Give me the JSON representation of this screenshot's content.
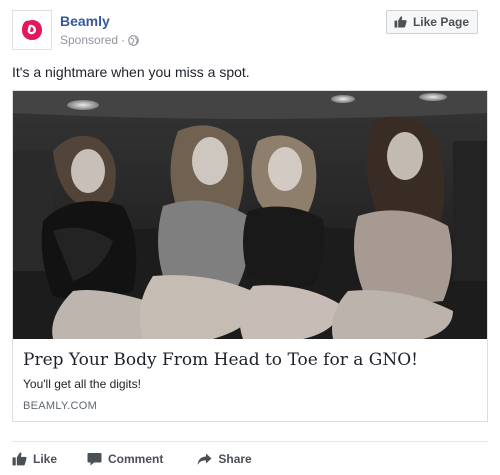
{
  "header": {
    "page_name": "Beamly",
    "sponsored": "Sponsored",
    "separator": "·",
    "like_page_label": "Like Page",
    "brand_color": "#e3175c"
  },
  "post": {
    "text": "It's a nightmare when you miss a spot."
  },
  "card": {
    "image_icon": "photo-four-women-in-limousine",
    "title": "Prep Your Body From Head to Toe for a GNO!",
    "description": "You'll get all the digits!",
    "domain": "BEAMLY.COM"
  },
  "actions": {
    "like": "Like",
    "comment": "Comment",
    "share": "Share"
  },
  "colors": {
    "link_blue": "#365899",
    "meta_gray": "#90949c",
    "action_gray": "#4b4f56"
  }
}
